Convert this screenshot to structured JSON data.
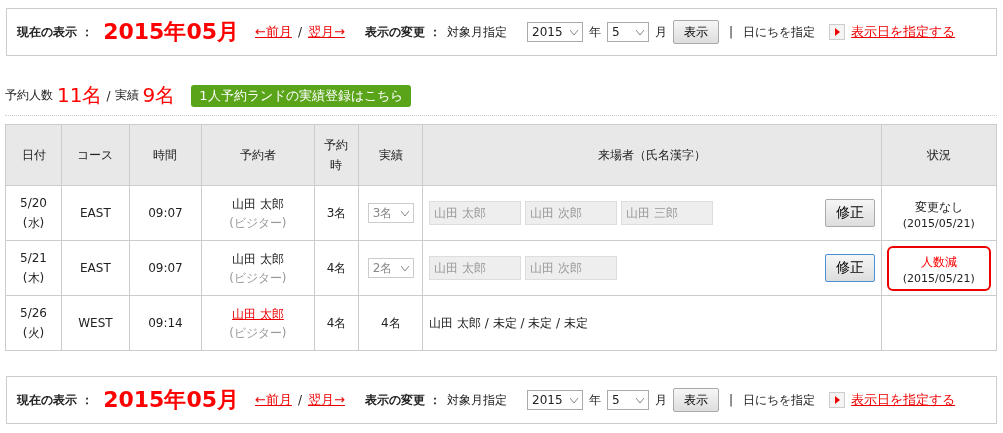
{
  "nav_bars": [
    {
      "current_label": "現在の表示 ：",
      "current_month": "2015年05月",
      "prev_link": "←前月",
      "separator": "/",
      "next_link": "翌月→",
      "change_label": "表示の変更 ：",
      "target_label": "対象月指定",
      "year_select": "2015",
      "year_unit": "年",
      "month_select": "5",
      "month_unit": "月",
      "show_button": "表示",
      "divider": "|",
      "day_label": "日にちを指定",
      "day_link": "表示日を指定する"
    },
    {
      "current_label": "現在の表示 ：",
      "current_month": "2015年05月",
      "prev_link": "←前月",
      "separator": "/",
      "next_link": "翌月→",
      "change_label": "表示の変更 ：",
      "target_label": "対象月指定",
      "year_select": "2015",
      "year_unit": "年",
      "month_select": "5",
      "month_unit": "月",
      "show_button": "表示",
      "divider": "|",
      "day_label": "日にちを指定",
      "day_link": "表示日を指定する"
    }
  ],
  "summary": {
    "reserved_label": "予約人数",
    "reserved_count": "11名",
    "separator": "/",
    "actual_label": "実績",
    "actual_count": "9名",
    "register_button": "1人予約ランドの実績登録はこちら"
  },
  "table": {
    "columns": [
      "日付",
      "コース",
      "時間",
      "予約者",
      "予約時",
      "実績",
      "来場者（氏名漢字）",
      "状況"
    ],
    "rows": [
      {
        "date": "5/20",
        "weekday": "(水)",
        "course": "EAST",
        "time": "09:07",
        "reserver": "山田 太郎",
        "reserver_linked": false,
        "reserver_type": "(ビジター)",
        "reserved": "3名",
        "actual": {
          "kind": "select",
          "value": "3名"
        },
        "visitors": {
          "kind": "inputs",
          "names": [
            "山田 太郎",
            "山田 次郎",
            "山田 三郎"
          ],
          "button": "修正",
          "button_focused": false
        },
        "status": {
          "text": "変更なし",
          "date": "(2015/05/21)",
          "alert": false
        }
      },
      {
        "date": "5/21",
        "weekday": "(木)",
        "course": "EAST",
        "time": "09:07",
        "reserver": "山田 太郎",
        "reserver_linked": false,
        "reserver_type": "(ビジター)",
        "reserved": "4名",
        "actual": {
          "kind": "select",
          "value": "2名"
        },
        "visitors": {
          "kind": "inputs",
          "names": [
            "山田 太郎",
            "山田 次郎"
          ],
          "button": "修正",
          "button_focused": true
        },
        "status": {
          "text": "人数減",
          "date": "(2015/05/21)",
          "alert": true
        }
      },
      {
        "date": "5/26",
        "weekday": "(火)",
        "course": "WEST",
        "time": "09:14",
        "reserver": "山田 太郎",
        "reserver_linked": true,
        "reserver_type": "(ビジター)",
        "reserved": "4名",
        "actual": {
          "kind": "text",
          "value": "4名"
        },
        "visitors": {
          "kind": "text",
          "text": "山田 太郎 / 未定 / 未定 / 未定"
        }
      }
    ]
  }
}
